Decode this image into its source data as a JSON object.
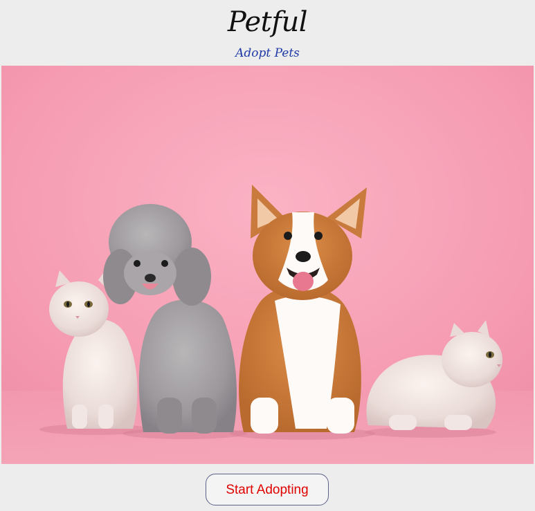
{
  "header": {
    "title": "Petful",
    "subtitle": "Adopt Pets"
  },
  "hero": {
    "image_subject": "two-cats-poodle-corgi-on-pink-background"
  },
  "footer": {
    "cta_label": "Start Adopting"
  },
  "colors": {
    "page_background": "#ededed",
    "subtitle": "#1f3aa8",
    "cta_text": "#e00000",
    "cta_border": "#5a5f8a",
    "hero_background": "#f7a7bb"
  }
}
